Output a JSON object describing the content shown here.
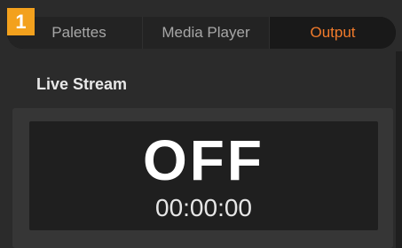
{
  "badge": {
    "number": "1",
    "color": "#f3a11d"
  },
  "tabs": [
    {
      "label": "Palettes",
      "active": false
    },
    {
      "label": "Media Player",
      "active": false
    },
    {
      "label": "Output",
      "active": true
    }
  ],
  "accent_color": "#f07a2b",
  "live_stream": {
    "title": "Live Stream",
    "status": "OFF",
    "timer": "00:00:00"
  }
}
